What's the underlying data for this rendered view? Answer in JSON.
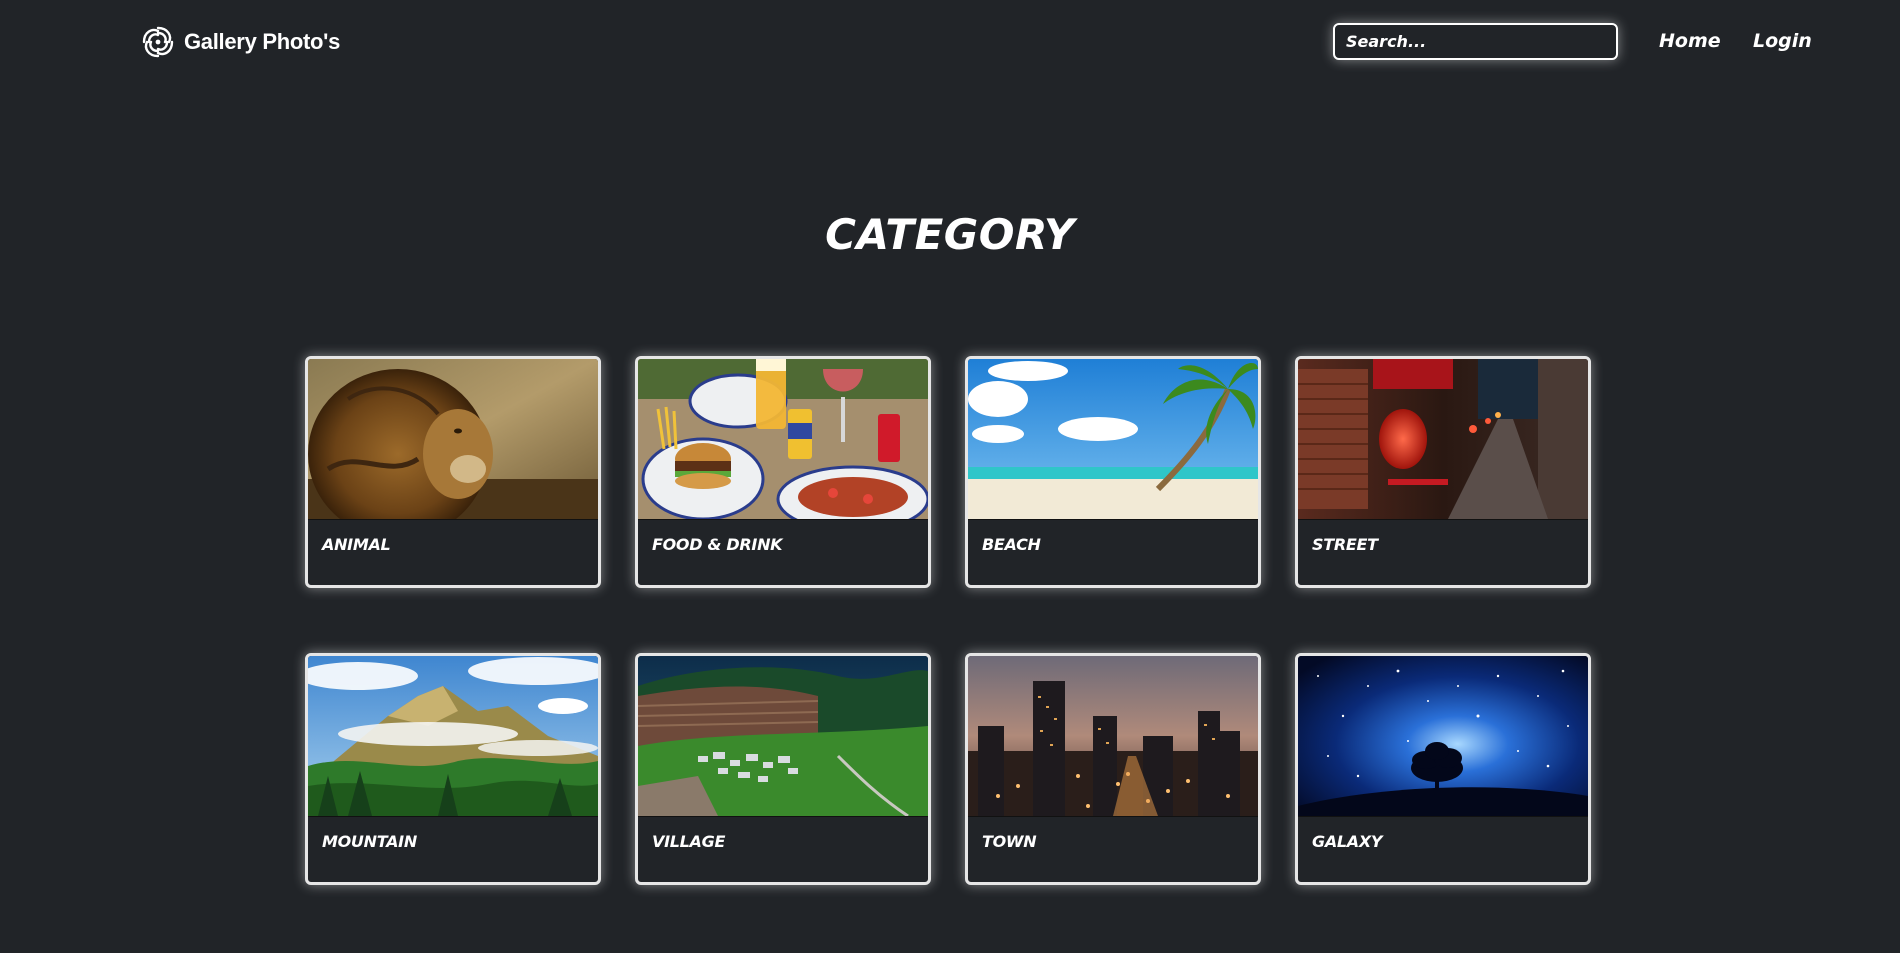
{
  "header": {
    "brand_name": "Gallery Photo's",
    "logo_icon": "swirl-logo-icon",
    "search": {
      "placeholder": "Search...",
      "value": ""
    },
    "nav": {
      "home": "Home",
      "login": "Login"
    }
  },
  "main": {
    "title": "CATEGORY",
    "categories": [
      {
        "label": "ANIMAL",
        "image": "lion-photo"
      },
      {
        "label": "FOOD & DRINK",
        "image": "burger-and-drinks-photo"
      },
      {
        "label": "BEACH",
        "image": "palm-beach-photo"
      },
      {
        "label": "STREET",
        "image": "lantern-alley-photo"
      },
      {
        "label": "MOUNTAIN",
        "image": "cloudy-mountain-photo"
      },
      {
        "label": "VILLAGE",
        "image": "hillside-village-photo"
      },
      {
        "label": "TOWN",
        "image": "city-skyline-photo"
      },
      {
        "label": "GALAXY",
        "image": "starry-night-tree-photo"
      }
    ]
  },
  "colors": {
    "background": "#212428",
    "text": "#ffffff",
    "card_border": "#e6e6e6"
  }
}
